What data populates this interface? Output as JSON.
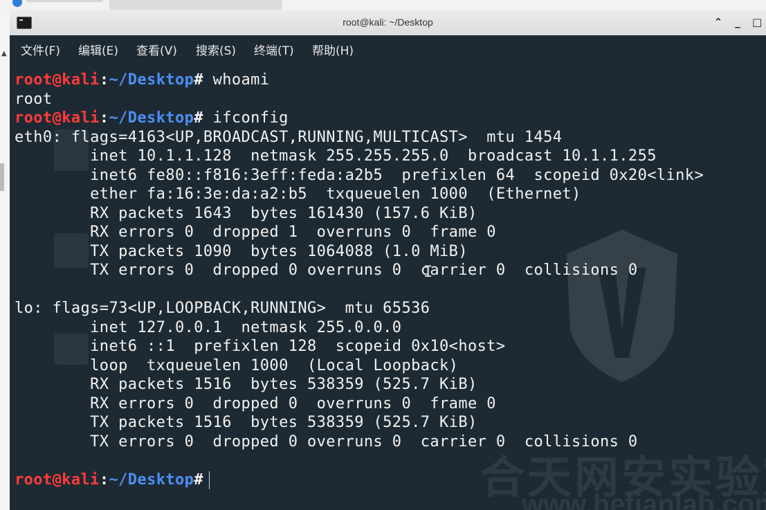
{
  "window": {
    "title": "root@kali: ~/Desktop",
    "buttons": {
      "up": "⌃",
      "minimize": "_",
      "maximize": "□"
    }
  },
  "menu": [
    {
      "label": "文件(F)"
    },
    {
      "label": "编辑(E)"
    },
    {
      "label": "查看(V)"
    },
    {
      "label": "搜索(S)"
    },
    {
      "label": "终端(T)"
    },
    {
      "label": "帮助(H)"
    }
  ],
  "prompt": {
    "user": "root@kali",
    "sep": ":",
    "path": "~/Desktop",
    "sym": "#"
  },
  "lines": [
    {
      "type": "prompt",
      "cmd": " whoami"
    },
    {
      "type": "out",
      "text": "root"
    },
    {
      "type": "prompt",
      "cmd": " ifconfig"
    },
    {
      "type": "out",
      "text": "eth0: flags=4163<UP,BROADCAST,RUNNING,MULTICAST>  mtu 1454"
    },
    {
      "type": "out",
      "text": "        inet 10.1.1.128  netmask 255.255.255.0  broadcast 10.1.1.255"
    },
    {
      "type": "out",
      "text": "        inet6 fe80::f816:3eff:feda:a2b5  prefixlen 64  scopeid 0x20<link>"
    },
    {
      "type": "out",
      "text": "        ether fa:16:3e:da:a2:b5  txqueuelen 1000  (Ethernet)"
    },
    {
      "type": "out",
      "text": "        RX packets 1643  bytes 161430 (157.6 KiB)"
    },
    {
      "type": "out",
      "text": "        RX errors 0  dropped 1  overruns 0  frame 0"
    },
    {
      "type": "out",
      "text": "        TX packets 1090  bytes 1064088 (1.0 MiB)"
    },
    {
      "type": "out",
      "text": "        TX errors 0  dropped 0 overruns 0  carrier 0  collisions 0"
    },
    {
      "type": "out",
      "text": ""
    },
    {
      "type": "out",
      "text": "lo: flags=73<UP,LOOPBACK,RUNNING>  mtu 65536"
    },
    {
      "type": "out",
      "text": "        inet 127.0.0.1  netmask 255.0.0.0"
    },
    {
      "type": "out",
      "text": "        inet6 ::1  prefixlen 128  scopeid 0x10<host>"
    },
    {
      "type": "out",
      "text": "        loop  txqueuelen 1000  (Local Loopback)"
    },
    {
      "type": "out",
      "text": "        RX packets 1516  bytes 538359 (525.7 KiB)"
    },
    {
      "type": "out",
      "text": "        RX errors 0  dropped 0  overruns 0  frame 0"
    },
    {
      "type": "out",
      "text": "        TX packets 1516  bytes 538359 (525.7 KiB)"
    },
    {
      "type": "out",
      "text": "        TX errors 0  dropped 0 overruns 0  carrier 0  collisions 0"
    },
    {
      "type": "out",
      "text": ""
    },
    {
      "type": "prompt",
      "cmd": ""
    }
  ],
  "watermark": {
    "cn": "合天网安实验室",
    "url": "www.hetianlab.com"
  },
  "colors": {
    "terminal_bg": "#1e2a33",
    "user": "#ff3b3b",
    "path": "#4c8ff5",
    "text": "#f2f2f2"
  }
}
